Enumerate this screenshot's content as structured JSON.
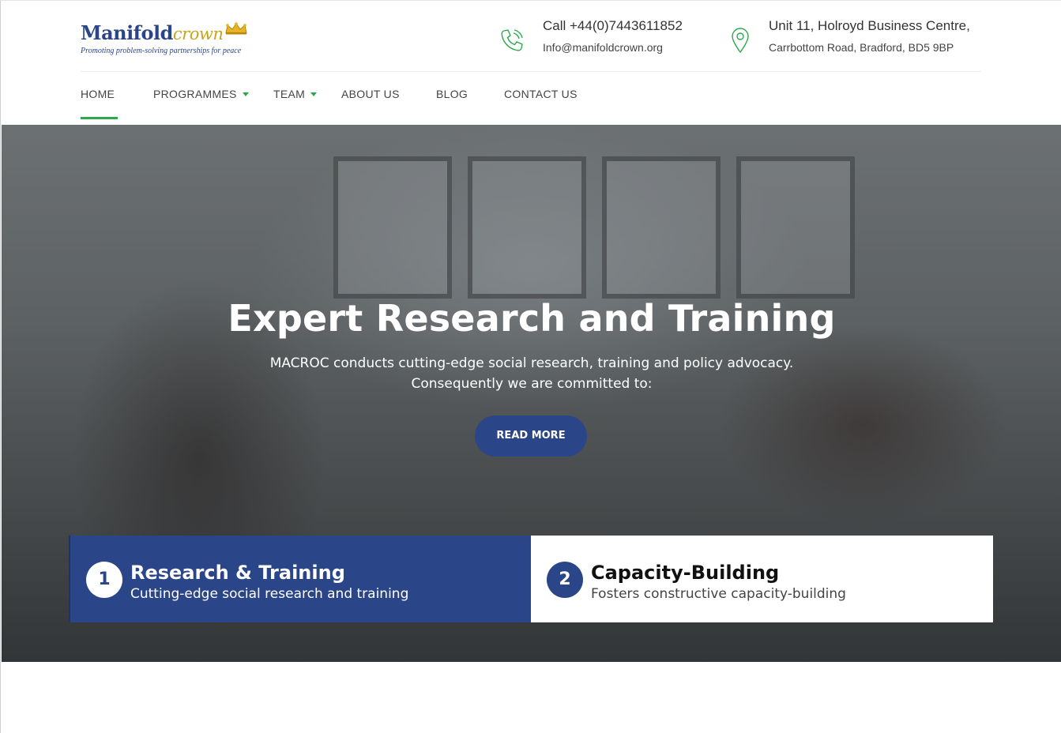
{
  "brand": {
    "name_main": "Manifold",
    "name_accent": "crown",
    "tagline": "Promoting problem-solving partnerships for peace"
  },
  "contact": {
    "phone_icon": "phone-icon",
    "phone": "Call +44(0)7443611852",
    "email": "Info@manifoldcrown.org",
    "location_icon": "map-pin-icon",
    "address_line1": "Unit 11, Holroyd Business Centre,",
    "address_line2": "Carrbottom Road, Bradford, BD5 9BP"
  },
  "nav": {
    "items": [
      {
        "label": "HOME",
        "active": true
      },
      {
        "label": "PROGRAMMES",
        "dropdown": true
      },
      {
        "label": "TEAM",
        "dropdown": true
      },
      {
        "label": "ABOUT US"
      },
      {
        "label": "BLOG"
      },
      {
        "label": "CONTACT US"
      }
    ]
  },
  "hero": {
    "title": "Expert Research and Training",
    "subtitle_line1": "MACROC conducts cutting-edge social research, training and policy advocacy.",
    "subtitle_line2": "Consequently we are committed to:",
    "button_label": "READ MORE"
  },
  "features": [
    {
      "number": "1",
      "title": "Research & Training",
      "description": "Cutting-edge social research and training"
    },
    {
      "number": "2",
      "title": "Capacity-Building",
      "description": "Fosters constructive capacity-building"
    }
  ],
  "colors": {
    "brand_blue": "#2b4589",
    "accent_green": "#2aa84a",
    "crown_gold": "#c7a418"
  }
}
